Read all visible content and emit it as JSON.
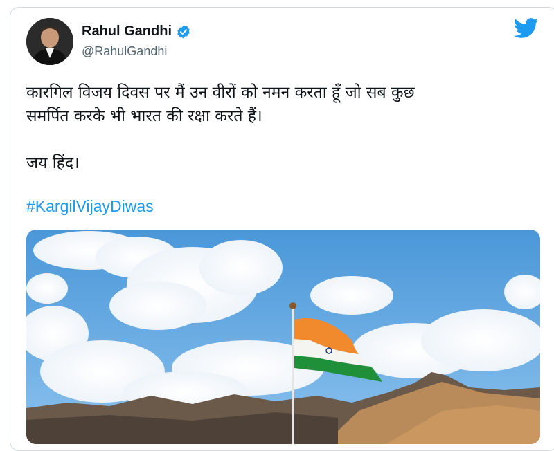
{
  "tweet": {
    "display_name": "Rahul Gandhi",
    "handle": "@RahulGandhi",
    "verified": true,
    "text_lines": [
      "कारगिल विजय दिवस पर मैं उन वीरों को नमन करता हूँ जो सब कुछ",
      "समर्पित करके भी भारत की रक्षा करते हैं।",
      "जय हिंद।"
    ],
    "hashtag": "#KargilVijayDiwas"
  },
  "icons": {
    "verified": "verified-badge-icon",
    "brand": "twitter-bird-icon"
  },
  "colors": {
    "link": "#1d9bf0",
    "verified": "#1d9bf0",
    "text": "#0f1419",
    "secondary": "#536471",
    "sky": "#5aa4e0",
    "saffron": "#f08a2c",
    "india_green": "#1f8f3a"
  }
}
